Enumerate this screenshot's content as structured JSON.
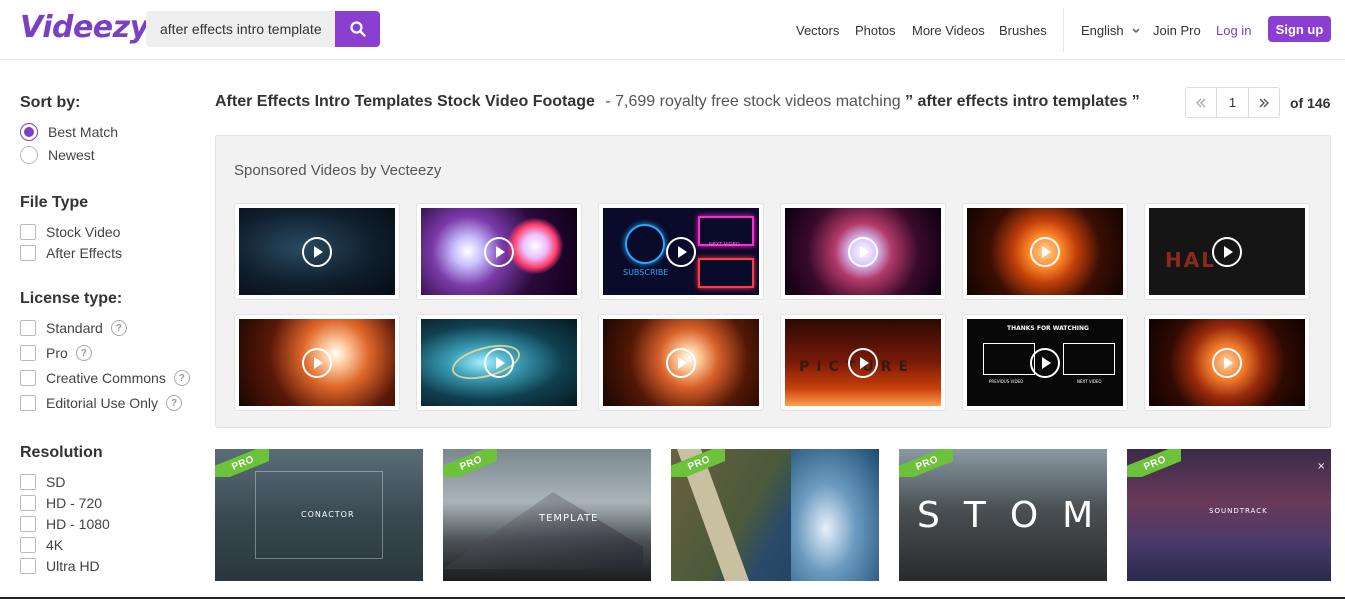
{
  "header": {
    "logo": "Videezy",
    "search": {
      "value": "after effects intro templates"
    },
    "nav": [
      "Vectors",
      "Photos",
      "More Videos",
      "Brushes"
    ],
    "language": "English",
    "join_pro": "Join Pro",
    "login": "Log in",
    "signup": "Sign up"
  },
  "sidebar": {
    "sort_by": {
      "heading": "Sort by:",
      "options": [
        "Best Match",
        "Newest"
      ],
      "selected": "Best Match"
    },
    "file_type": {
      "heading": "File Type",
      "options": [
        "Stock Video",
        "After Effects"
      ]
    },
    "license_type": {
      "heading": "License type:",
      "options": [
        "Standard",
        "Pro",
        "Creative Commons",
        "Editorial Use Only"
      ]
    },
    "resolution": {
      "heading": "Resolution",
      "options": [
        "SD",
        "HD - 720",
        "HD - 1080",
        "4K",
        "Ultra HD"
      ]
    }
  },
  "results": {
    "title": "After Effects Intro Templates Stock Video Footage",
    "count_text": "- 7,699 royalty free stock videos matching",
    "query_quoted": "” after effects intro templates ”",
    "page": "1",
    "of_pages": "of 146"
  },
  "sponsored": {
    "label": "Sponsored Videos by Vecteezy",
    "thumb_texts": {
      "subscribe": "SUBSCRIBE",
      "next_video": "NEXT VIDEO",
      "hal": "HAL",
      "picture": "PICTURE",
      "thanks": "THANKS FOR WATCHING",
      "previous_video": "PREVIOUS VIDEO",
      "next_video_2": "NEXT VIDEO"
    }
  },
  "pro_cards": {
    "badge": "PRO",
    "texts": [
      "CONACTOR",
      "TEMPLATE",
      "STOMP",
      "SOUNDTRACK"
    ]
  },
  "colors": {
    "brand": "#7b3fc4",
    "button": "#8a3fd1",
    "pro_badge": "#6cc23a"
  }
}
